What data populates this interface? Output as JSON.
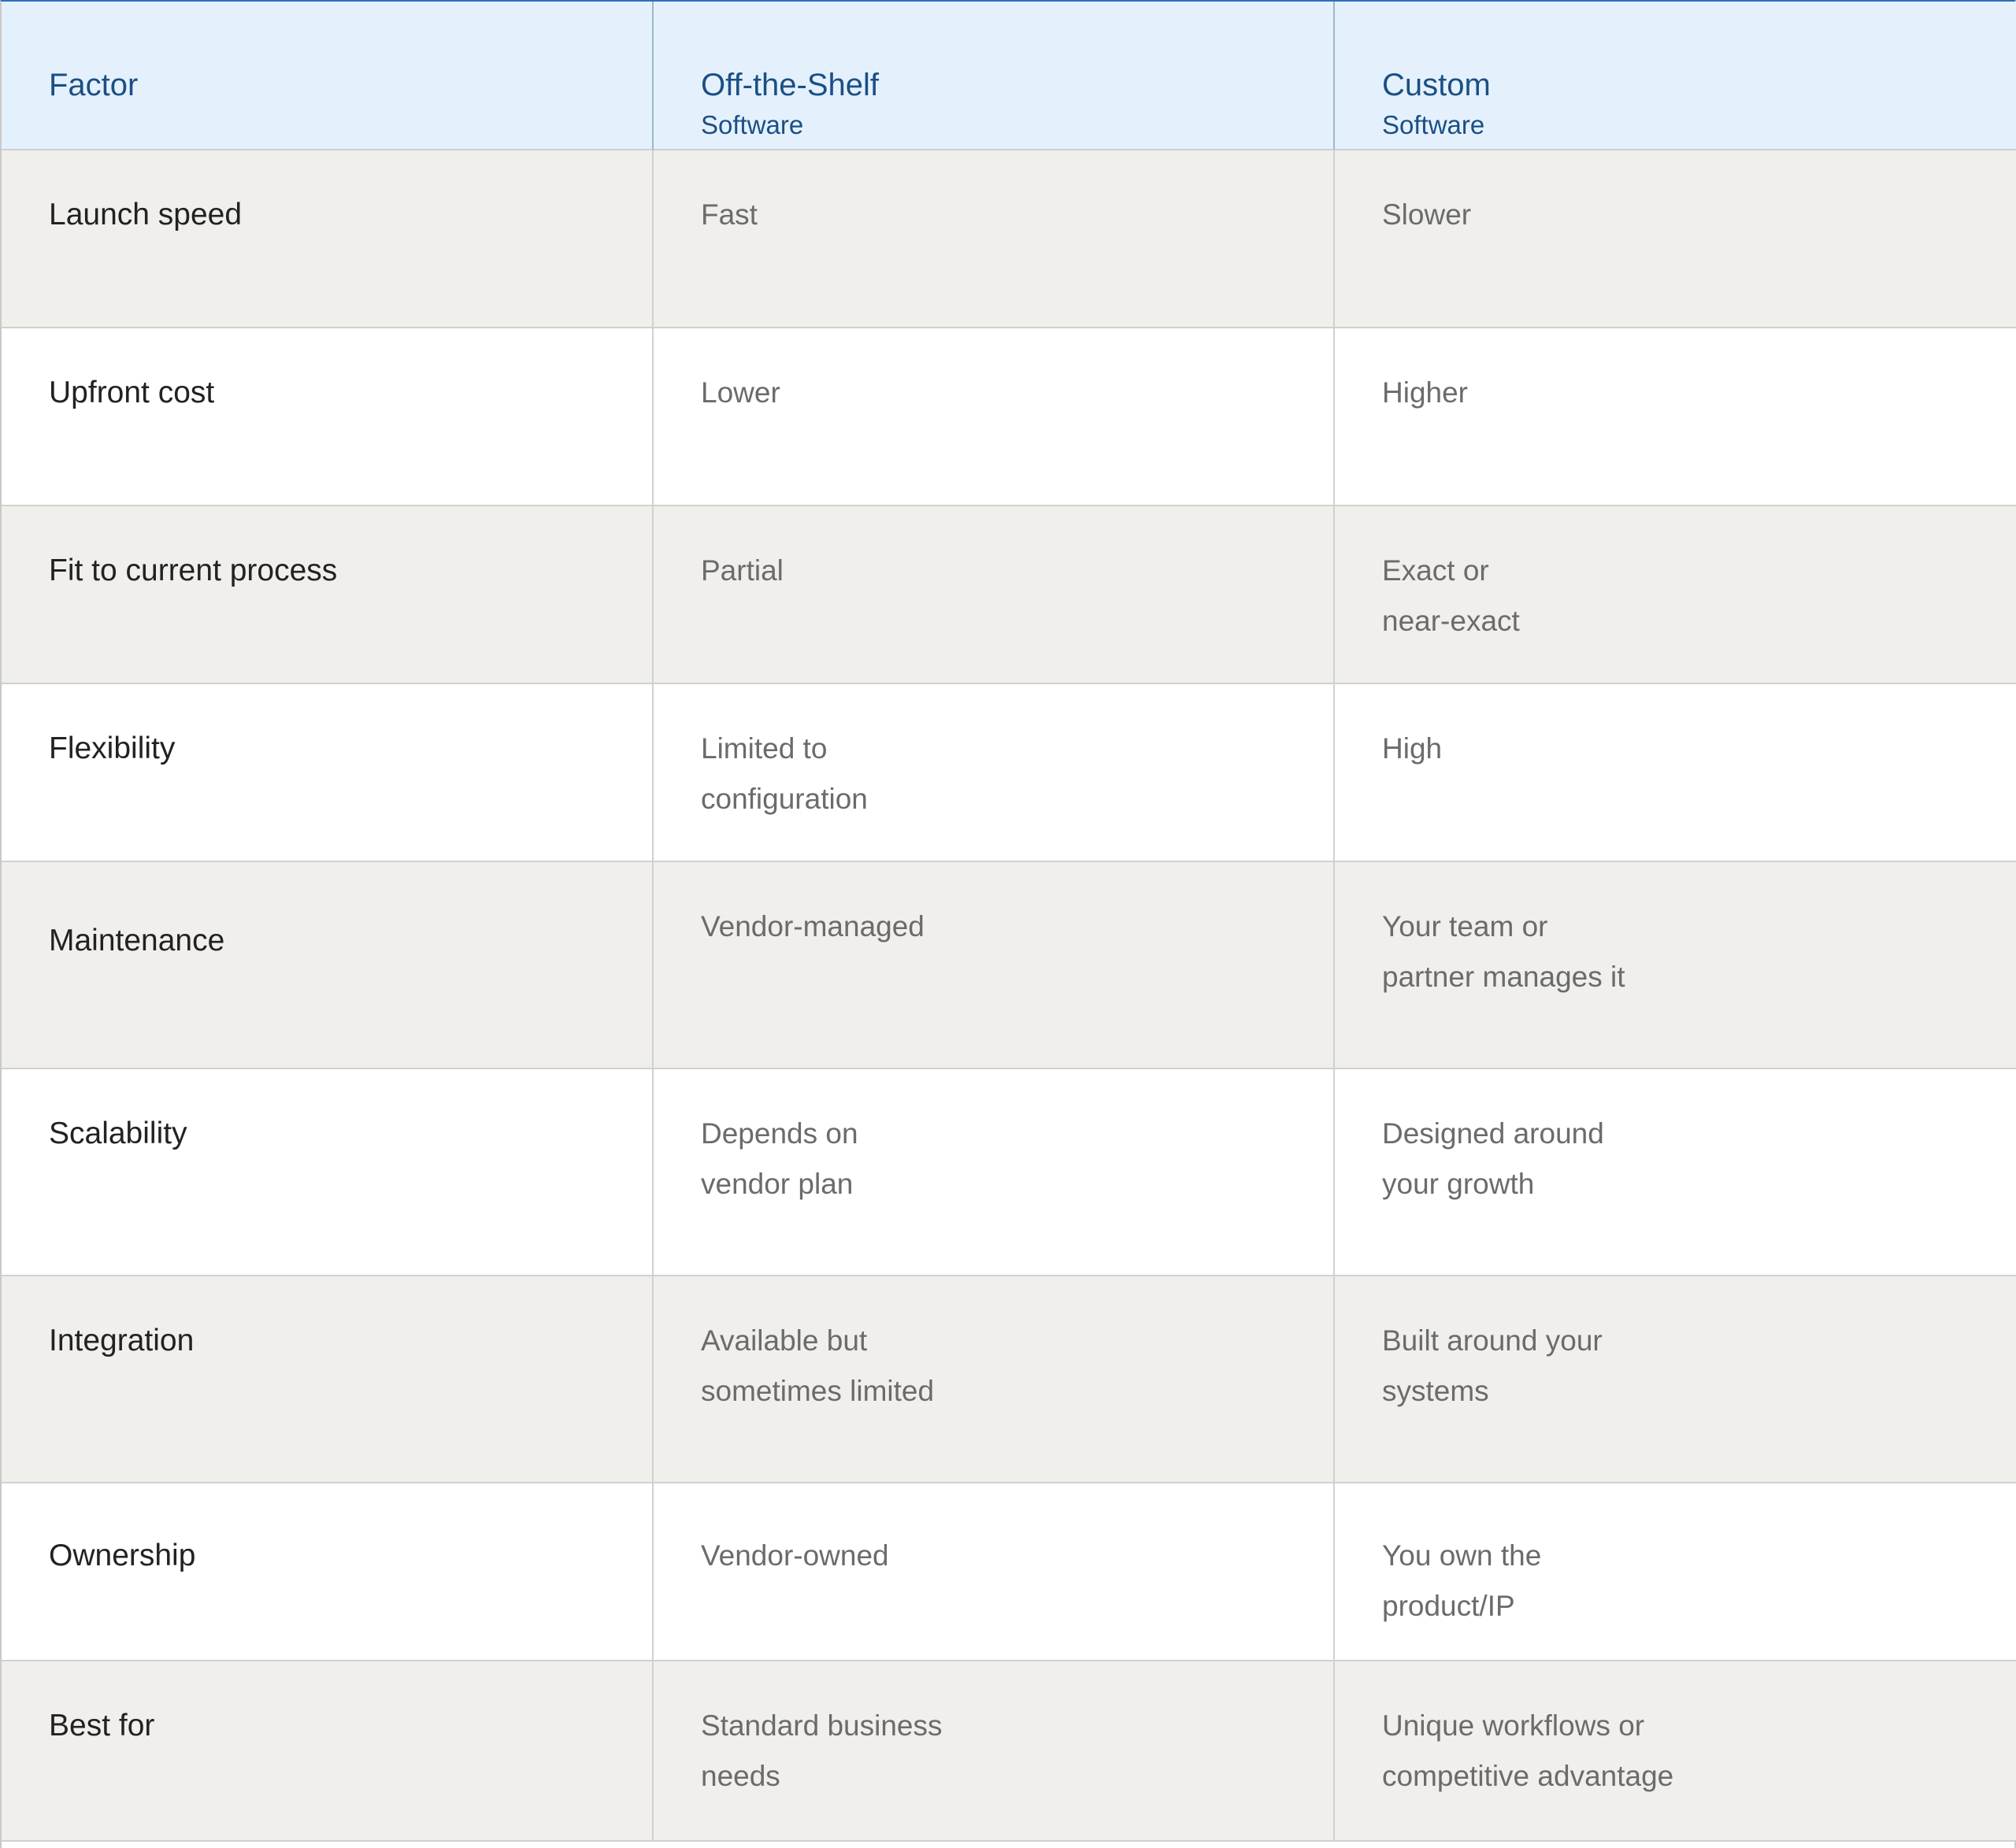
{
  "header": {
    "factor": "Factor",
    "off_the_shelf": {
      "title": "Off-the-Shelf",
      "subtitle": "Software"
    },
    "custom": {
      "title": "Custom",
      "subtitle": "Software"
    }
  },
  "rows": [
    {
      "factor": "Launch speed",
      "off_the_shelf": [
        "Fast"
      ],
      "custom": [
        "Slower"
      ]
    },
    {
      "factor": "Upfront cost",
      "off_the_shelf": [
        "Lower"
      ],
      "custom": [
        "Higher"
      ]
    },
    {
      "factor": "Fit to current process",
      "off_the_shelf": [
        "Partial"
      ],
      "custom": [
        "Exact or",
        "near-exact"
      ]
    },
    {
      "factor": "Flexibility",
      "off_the_shelf": [
        "Limited to",
        "configuration"
      ],
      "custom": [
        "High"
      ]
    },
    {
      "factor": "Maintenance",
      "off_the_shelf": [
        "Vendor-managed"
      ],
      "custom": [
        "Your team or",
        "partner manages it"
      ]
    },
    {
      "factor": "Scalability",
      "off_the_shelf": [
        "Depends on",
        "vendor plan"
      ],
      "custom": [
        "Designed around",
        "your growth"
      ]
    },
    {
      "factor": "Integration",
      "off_the_shelf": [
        "Available but",
        "sometimes limited"
      ],
      "custom": [
        "Built around your",
        "systems"
      ]
    },
    {
      "factor": "Ownership",
      "off_the_shelf": [
        "Vendor-owned"
      ],
      "custom": [
        "You own the",
        "product/IP"
      ]
    },
    {
      "factor": "Best for",
      "off_the_shelf": [
        "Standard business",
        "needs"
      ],
      "custom": [
        "Unique workflows or",
        "competitive advantage"
      ]
    }
  ]
}
